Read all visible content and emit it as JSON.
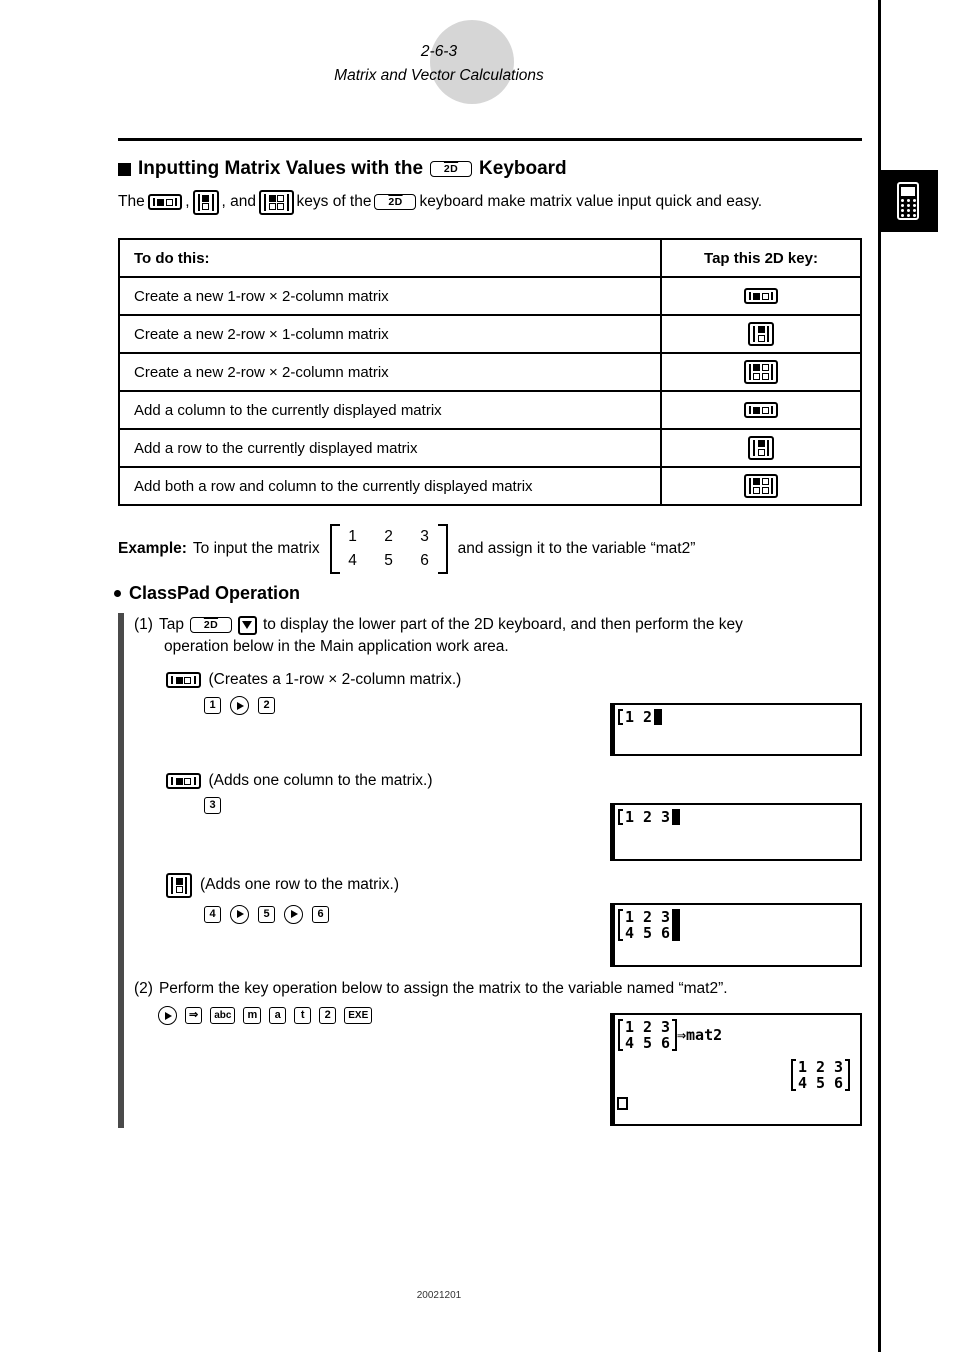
{
  "header": {
    "page_number": "2-6-3",
    "chapter_title": "Matrix and Vector Calculations"
  },
  "side_tab": {
    "icon": "calculator-icon"
  },
  "section": {
    "bullet": "square-bullet",
    "heading_part1": "Inputting Matrix Values with the",
    "heading_key": "2D",
    "heading_part2": "Keyboard",
    "intro_part1": "The",
    "intro_comma1": ",",
    "intro_and": ", and",
    "intro_part2": "keys of the",
    "intro_key": "2D",
    "intro_part3": "keyboard make matrix value input quick and easy."
  },
  "table": {
    "headers": [
      "To do this:",
      "Tap this 2D key:"
    ],
    "rows": [
      {
        "action": "Create a new 1-row × 2-column matrix",
        "key": "matrix-1x2-icon"
      },
      {
        "action": "Create a new 2-row × 1-column matrix",
        "key": "matrix-2x1-icon"
      },
      {
        "action": "Create a new 2-row × 2-column matrix",
        "key": "matrix-2x2-icon"
      },
      {
        "action": "Add a column to the currently displayed matrix",
        "key": "matrix-1x2-icon"
      },
      {
        "action": "Add a row to the currently displayed matrix",
        "key": "matrix-2x1-icon"
      },
      {
        "action": "Add both a row and column to the currently displayed matrix",
        "key": "matrix-2x2-icon"
      }
    ]
  },
  "example": {
    "label": "Example:",
    "text_before": "To input the matrix",
    "matrix": [
      [
        "1",
        "2",
        "3"
      ],
      [
        "4",
        "5",
        "6"
      ]
    ],
    "text_after": "and assign it to the variable “mat2”"
  },
  "classpad_operation": {
    "heading": "ClassPad Operation",
    "step1": {
      "number": "(1)",
      "text_before": "Tap",
      "key_2d": "2D",
      "key_down": "down-arrow-key",
      "text_after": "to display the lower part of the 2D keyboard, and then perform the key",
      "text_line2": "operation below in the Main application work area."
    },
    "operations": [
      {
        "key_icon": "matrix-1x2-icon",
        "description": "(Creates a 1-row × 2-column matrix.)",
        "keys": [
          "1",
          "right-arrow-key",
          "2"
        ]
      },
      {
        "key_icon": "matrix-1x2-icon",
        "description": "(Adds one column to the matrix.)",
        "keys": [
          "3"
        ]
      },
      {
        "key_icon": "matrix-2x1-icon",
        "description": "(Adds one row to the matrix.)",
        "keys": [
          "4",
          "right-arrow-key",
          "5",
          "right-arrow-key",
          "6"
        ]
      }
    ],
    "step2": {
      "number": "(2)",
      "text": "Perform the key operation below to assign the matrix to the variable named “mat2”.",
      "keys": [
        "right-arrow-key",
        "assign-arrow-key",
        "abc",
        "m",
        "a",
        "t",
        "2",
        "EXE"
      ]
    }
  },
  "screens": [
    {
      "name": "screen-1-row-2-col",
      "matrix": [
        [
          "1",
          "2"
        ]
      ]
    },
    {
      "name": "screen-1-row-3-col",
      "matrix": [
        [
          "1",
          "2",
          "3"
        ]
      ]
    },
    {
      "name": "screen-2-row-3-col",
      "matrix": [
        [
          "1",
          "2",
          "3"
        ],
        [
          "4",
          "5",
          "6"
        ]
      ]
    },
    {
      "name": "screen-assign-mat2",
      "matrix": [
        [
          "1",
          "2",
          "3"
        ],
        [
          "4",
          "5",
          "6"
        ]
      ],
      "assign_text": "⇒mat2",
      "result_matrix": [
        [
          "1",
          "2",
          "3"
        ],
        [
          "4",
          "5",
          "6"
        ]
      ]
    }
  ],
  "footer": {
    "text": "20021201"
  }
}
